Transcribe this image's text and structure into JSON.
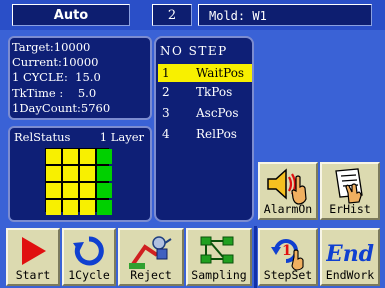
{
  "header": {
    "mode": "Auto",
    "cycle_no": "2",
    "mold": "Mold: W1"
  },
  "counters": {
    "target": "Target:10000",
    "current": "Current:10000",
    "one_cycle": "1 CYCLE:  15.0",
    "tktime": "TkTime :    5.0",
    "daycount": "1DayCount:5760"
  },
  "relstatus": {
    "title": "RelStatus",
    "layer": "1 Layer",
    "grid": [
      [
        "yellow",
        "yellow",
        "yellow",
        "green"
      ],
      [
        "yellow",
        "yellow",
        "yellow",
        "green"
      ],
      [
        "yellow",
        "yellow",
        "yellow",
        "green"
      ],
      [
        "yellow",
        "yellow",
        "yellow",
        "green"
      ]
    ]
  },
  "steps": {
    "header": "NO STEP",
    "items": [
      {
        "no": "1",
        "name": "WaitPos",
        "selected": true
      },
      {
        "no": "2",
        "name": "TkPos",
        "selected": false
      },
      {
        "no": "3",
        "name": "AscPos",
        "selected": false
      },
      {
        "no": "4",
        "name": "RelPos",
        "selected": false
      }
    ]
  },
  "buttons": {
    "alarm_on": "AlarmOn",
    "er_hist": "ErHist",
    "start": "Start",
    "one_cycle": "1Cycle",
    "reject": "Reject",
    "sampling": "Sampling",
    "step_set": "StepSet",
    "end_work": "EndWork",
    "end_icon_text": "End",
    "stepset_icon_text": "1"
  },
  "colors": {
    "yellow": "#f8f000",
    "green": "#00d000",
    "start_red": "#e01010",
    "cycle_blue": "#1040d0"
  }
}
